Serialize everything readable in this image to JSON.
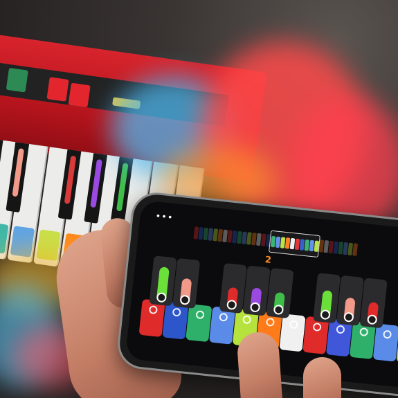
{
  "photo": {
    "subject": "hands-holding-phone-with-keyboard-app",
    "app": {
      "menu_icon": "more-dots-icon",
      "menu_glyph": "•••",
      "octave_number": "2"
    },
    "colors": {
      "keyboard_red": "#d8242c",
      "smoke_red": "#ff4a4a",
      "smoke_blue": "#4fb8f0",
      "smoke_orange": "#ff9a2a",
      "accent_orange": "#ff8c1a"
    },
    "phone_pads": [
      {
        "color": "#e02b2b"
      },
      {
        "color": "#2c56c9"
      },
      {
        "color": "#2fb06a"
      },
      {
        "color": "#5b8be8"
      },
      {
        "color": "#b5e23c"
      },
      {
        "color": "#ff7a18"
      },
      {
        "color": "#f0f0f0"
      },
      {
        "color": "#e02b2b"
      },
      {
        "color": "#3f57d8"
      },
      {
        "color": "#2fb06a"
      },
      {
        "color": "#5b8be8"
      },
      {
        "color": "#b5e23c"
      }
    ],
    "phone_bars": [
      {
        "color": "#6be03a",
        "level": 0.8
      },
      {
        "color": "#f29a8a",
        "level": 0.6
      },
      {
        "color": "#e02b2b",
        "level": 0.5
      },
      {
        "color": "#9a4ae0",
        "level": 0.55
      },
      {
        "color": "#3fbf4a",
        "level": 0.5
      },
      {
        "color": "#6be03a",
        "level": 0.65
      },
      {
        "color": "#f29a8a",
        "level": 0.55
      },
      {
        "color": "#e02b2b",
        "level": 0.5
      }
    ]
  }
}
